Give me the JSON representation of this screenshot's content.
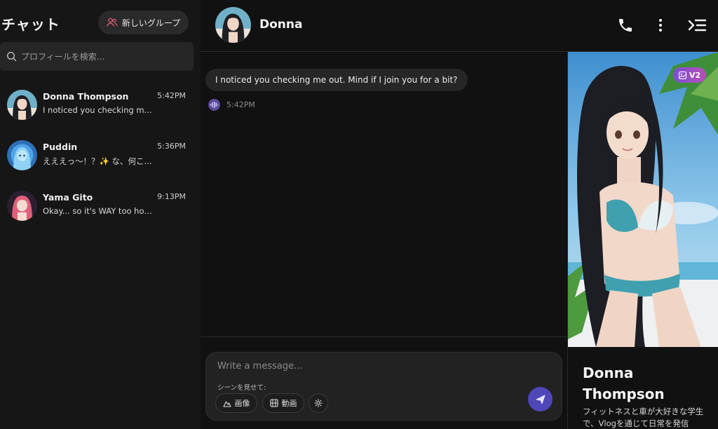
{
  "sidebar": {
    "title": "チャット",
    "new_group_label": "新しいグループ",
    "search_placeholder": "プロフィールを検索...",
    "chats": [
      {
        "name": "Donna Thompson",
        "time": "5:42PM",
        "preview": "I noticed you checking m..."
      },
      {
        "name": "Puddin",
        "time": "5:36PM",
        "preview": "えええっ〜！？✨ な、何こ..."
      },
      {
        "name": "Yama Gito",
        "time": "9:13PM",
        "preview": "Okay... so it's WAY too hot ..."
      }
    ]
  },
  "header": {
    "name": "Donna"
  },
  "messages": [
    {
      "text": "I noticed you checking me out. Mind if I join you for a bit?",
      "time": "5:42PM"
    }
  ],
  "composer": {
    "placeholder": "Write a message...",
    "scene_label": "シーンを見せて:",
    "image_label": "画像",
    "video_label": "動画"
  },
  "profile": {
    "badge": "V2",
    "name": "Donna Thompson",
    "bio": "フィットネスと車が大好きな学生で、Vlogを通じて日常を発信"
  },
  "colors": {
    "accent": "#4f46b8",
    "badge_start": "#7d4fd6",
    "badge_end": "#b64fb5"
  }
}
